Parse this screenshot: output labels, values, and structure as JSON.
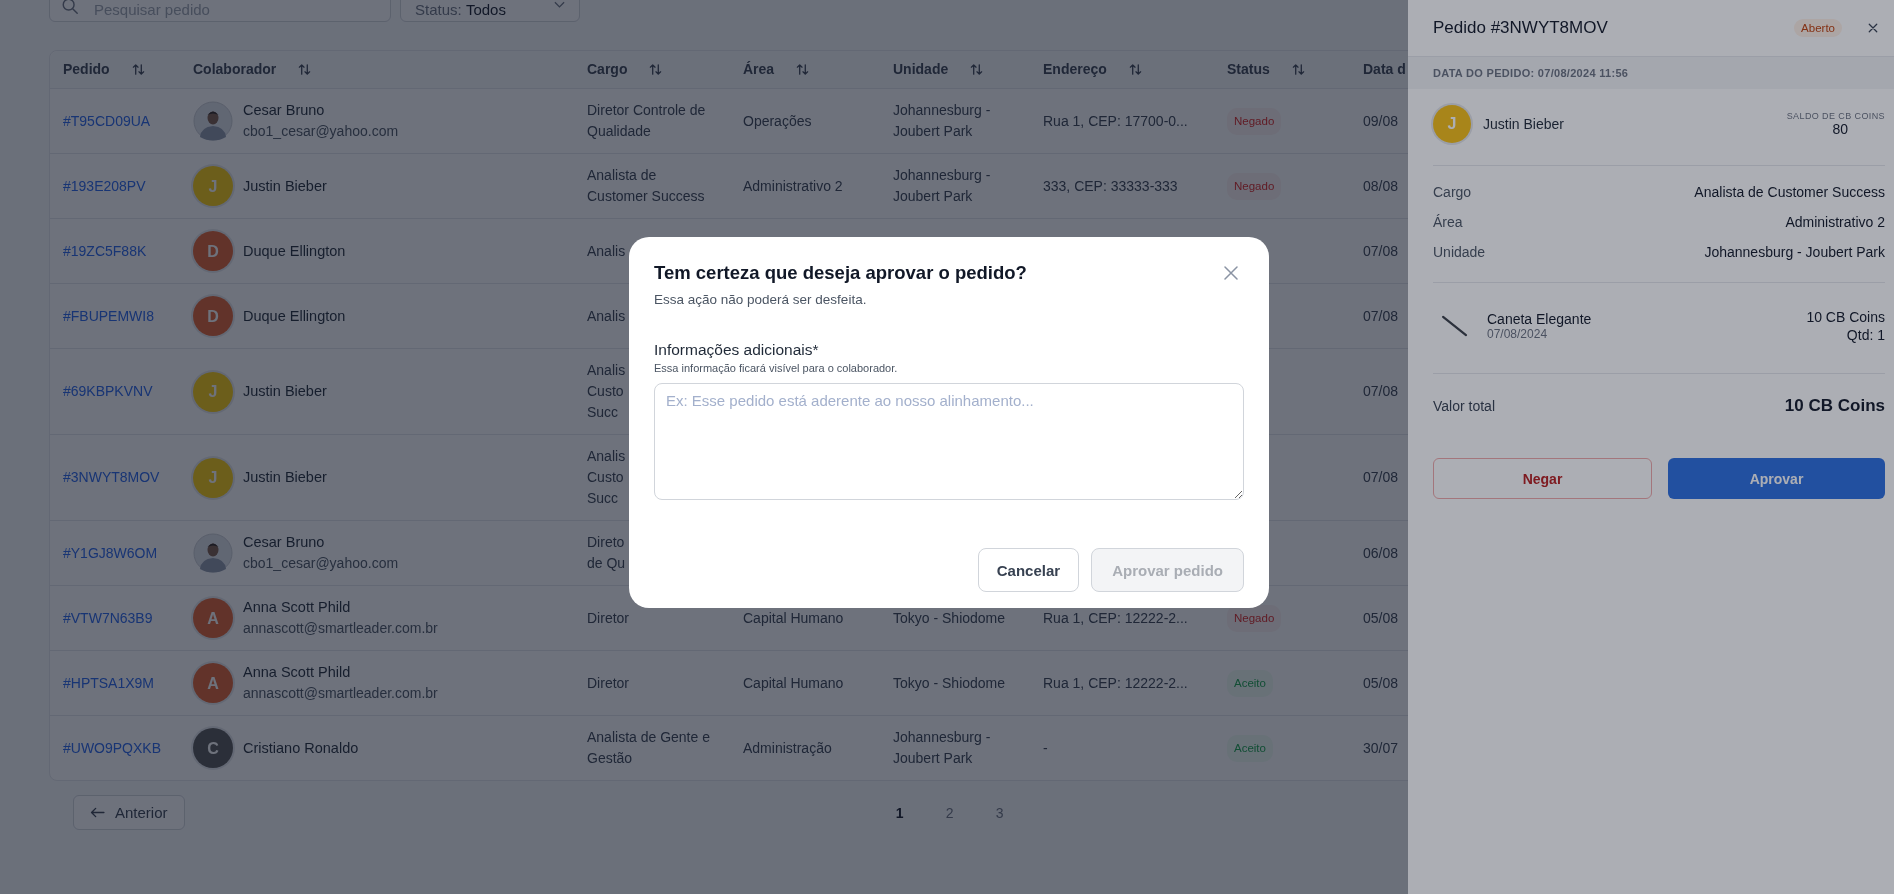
{
  "filters": {
    "search": {
      "placeholder": "Pesquisar pedido"
    },
    "status": {
      "label": "Status:",
      "value": "Todos"
    }
  },
  "table": {
    "columns": [
      {
        "label": "Pedido",
        "sortable": true
      },
      {
        "label": "Colaborador",
        "sortable": true
      },
      {
        "label": "Cargo",
        "sortable": true
      },
      {
        "label": "Área",
        "sortable": true
      },
      {
        "label": "Unidade",
        "sortable": true
      },
      {
        "label": "Endereço",
        "sortable": true
      },
      {
        "label": "Status",
        "sortable": true
      },
      {
        "label": "Data d"
      }
    ],
    "rows": [
      {
        "id": "#T95CD09UA",
        "name": "Cesar Bruno",
        "email": "cbo1_cesar@yahoo.com",
        "cargo": "Diretor Controle de Qualidade",
        "area": "Operações",
        "unidade": "Johannesburg - Joubert Park",
        "endereco": "Rua 1, CEP: 17700-0...",
        "status": {
          "text": "Negado",
          "kind": "denied"
        },
        "date": "09/08"
      },
      {
        "id": "#193E208PV",
        "name": "Justin Bieber",
        "avatar": {
          "kind": "initial",
          "initial": "J",
          "color": "#6c5e1b"
        },
        "cargo": "Analista de Customer Success",
        "area": "Administrativo 2",
        "unidade": "Johannesburg - Joubert Park",
        "endereco": "333, CEP: 33333-333",
        "status": {
          "text": "Negado",
          "kind": "denied"
        },
        "date": "08/08"
      },
      {
        "id": "#19ZC5F88K",
        "name": "Duque Ellington",
        "avatar": {
          "kind": "initial",
          "initial": "D",
          "color": "#62342a"
        },
        "cargo": "Analis",
        "date": "07/08"
      },
      {
        "id": "#FBUPEMWI8",
        "name": "Duque Ellington",
        "avatar": {
          "kind": "initial",
          "initial": "D",
          "color": "#62342a"
        },
        "cargo": "Analis",
        "date": "07/08"
      },
      {
        "id": "#69KBPKVNV",
        "name": "Justin Bieber",
        "avatar": {
          "kind": "initial",
          "initial": "J",
          "color": "#6c5e1b"
        },
        "cargo": "Analis\nCusto\nSucc",
        "date": "07/08"
      },
      {
        "id": "#3NWYT8MOV",
        "name": "Justin Bieber",
        "avatar": {
          "kind": "initial",
          "initial": "J",
          "color": "#6c5e1b"
        },
        "cargo": "Analis\nCusto\nSucc",
        "date": "07/08"
      },
      {
        "id": "#Y1GJ8W6OM",
        "name": "Cesar Bruno",
        "email": "cbo1_cesar@yahoo.com",
        "cargo": "Direto\nde Qu",
        "date": "06/08"
      },
      {
        "id": "#VTW7N63B9",
        "name": "Anna Scott Phild",
        "email": "annascott@smartleader.com.br",
        "avatar": {
          "kind": "initial",
          "initial": "A",
          "color": "#62342a"
        },
        "cargo": "Diretor",
        "area": "Capital Humano",
        "unidade": "Tokyo - Shiodome",
        "endereco": "Rua 1, CEP: 12222-2...",
        "status": {
          "text": "Negado",
          "kind": "denied"
        },
        "date": "05/08"
      },
      {
        "id": "#HPTSA1X9M",
        "name": "Anna Scott Phild",
        "email": "annascott@smartleader.com.br",
        "avatar": {
          "kind": "initial",
          "initial": "A",
          "color": "#62342a"
        },
        "cargo": "Diretor",
        "area": "Capital Humano",
        "unidade": "Tokyo - Shiodome",
        "endereco": "Rua 1, CEP: 12222-2...",
        "status": {
          "text": "Aceito",
          "kind": "accepted"
        },
        "date": "05/08"
      },
      {
        "id": "#UWO9PQXKB",
        "name": "Cristiano Ronaldo",
        "avatar": {
          "kind": "initial",
          "initial": "C",
          "color": "#2c3039"
        },
        "cargo": "Analista de Gente e Gestão",
        "area": "Administração",
        "unidade": "Johannesburg - Joubert Park",
        "endereco": "-",
        "status": {
          "text": "Aceito",
          "kind": "accepted"
        },
        "date": "30/07"
      }
    ]
  },
  "pagination": {
    "previous": "Anterior",
    "pages": [
      {
        "label": "1",
        "selected": true
      },
      {
        "label": "2",
        "selected": false
      },
      {
        "label": "3",
        "selected": false
      }
    ]
  },
  "drawer": {
    "title": "Pedido #3NWYT8MOV",
    "status": {
      "text": "Aberto",
      "kind": "open"
    },
    "date_band": "DATA DO PEDIDO: 07/08/2024 11:56",
    "customer": {
      "name": "Justin Bieber",
      "avatar": {
        "kind": "initial",
        "initial": "J",
        "color": "#a8861a"
      },
      "balance_label": "SALDO DE CB COINS",
      "balance": "80"
    },
    "details": [
      {
        "label": "Cargo",
        "value": "Analista de Customer Success"
      },
      {
        "label": "Área",
        "value": "Administrativo 2"
      },
      {
        "label": "Unidade",
        "value": "Johannesburg - Joubert Park"
      }
    ],
    "product": {
      "name": "Caneta Elegante",
      "date": "07/08/2024",
      "price": "10 CB Coins",
      "quantity": "Qtd: 1"
    },
    "total": {
      "label": "Valor total",
      "value": "10 CB Coins"
    },
    "buttons": [
      {
        "label": "Negar",
        "kind": "deny"
      },
      {
        "label": "Aprovar",
        "kind": "approve"
      }
    ]
  },
  "modal": {
    "title": "Tem certeza que deseja aprovar o pedido?",
    "subtitle": "Essa ação não poderá ser desfeita.",
    "field_label": "Informações adicionais*",
    "field_hint": "Essa informação ficará visível para o colaborador.",
    "placeholder": "Ex: Esse pedido está aderente ao nosso alinhamento...",
    "buttons": [
      {
        "label": "Cancelar",
        "disabled": false
      },
      {
        "label": "Aprovar pedido",
        "disabled": true
      }
    ]
  }
}
